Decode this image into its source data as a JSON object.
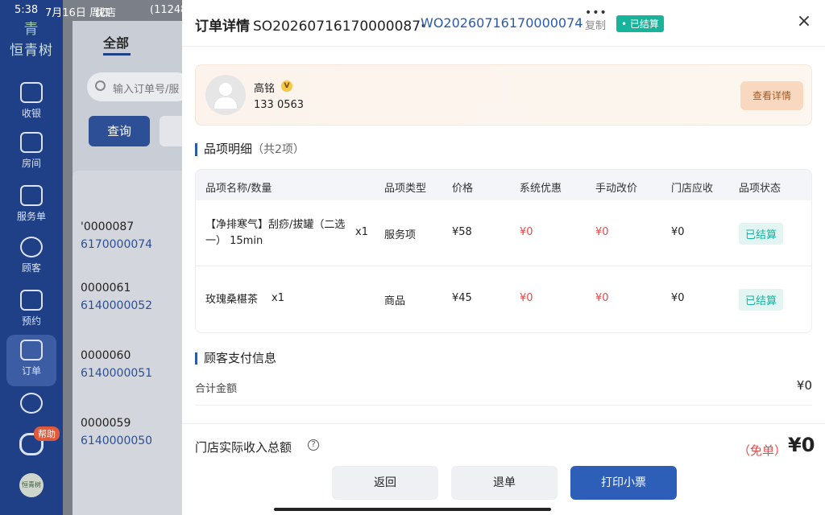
{
  "status_bar": {
    "time": "5:38",
    "date": "7月16日 周四",
    "store": "优店",
    "code": "(11248"
  },
  "sidebar": {
    "brand_mark": "青",
    "brand": "恒青树",
    "items": [
      {
        "label": "收银"
      },
      {
        "label": "房间"
      },
      {
        "label": "服务单"
      },
      {
        "label": "顾客"
      },
      {
        "label": "预约"
      },
      {
        "label": "订单"
      }
    ],
    "help_badge": "帮助",
    "mini_logo": "恒青树"
  },
  "background": {
    "tab_all": "全部",
    "search_placeholder": "输入订单号/服",
    "query_button": "查询",
    "orders": [
      {
        "line1": "'0000087",
        "line2": "6170000074"
      },
      {
        "line1": "0000061",
        "line2": "6140000052"
      },
      {
        "line1": "0000060",
        "line2": "6140000051"
      },
      {
        "line1": "0000059",
        "line2": "6140000050"
      }
    ]
  },
  "modal": {
    "grab": "•••",
    "title": "订单详情",
    "so_number": "SO20260716170000087",
    "separator": "·",
    "wo_number": "WO20260716170000074",
    "copy": "复制",
    "status_badge": "• 已结算",
    "close": "×",
    "customer": {
      "name": "高铭",
      "vip": "V",
      "phone": "133      0563",
      "detail_button": "查看详情"
    },
    "items_section": {
      "title": "品项明细",
      "count": "（共2项）"
    },
    "table": {
      "headers": [
        "品项名称/数量",
        "品项类型",
        "价格",
        "系统优惠",
        "手动改价",
        "门店应收",
        "品项状态"
      ],
      "rows": [
        {
          "name": "【净排寒气】刮痧/拔罐（二选一） 15min",
          "qty": "x1",
          "type": "服务项",
          "price": "¥58",
          "sys_discount": "¥0",
          "manual": "¥0",
          "receivable": "¥0",
          "status": "已结算"
        },
        {
          "name": "玫瑰桑椹茶",
          "qty": "x1",
          "type": "商品",
          "price": "¥45",
          "sys_discount": "¥0",
          "manual": "¥0",
          "receivable": "¥0",
          "status": "已结算"
        }
      ]
    },
    "payment_section": {
      "title": "顾客支付信息"
    },
    "payment": [
      {
        "label": "合计金额",
        "value": "¥0"
      }
    ],
    "footer": {
      "total_label": "门店实际收入总额",
      "help": "?",
      "free_tag": "（免单）",
      "total_value": "¥0",
      "back": "返回",
      "refund": "退单",
      "print": "打印小票"
    }
  }
}
